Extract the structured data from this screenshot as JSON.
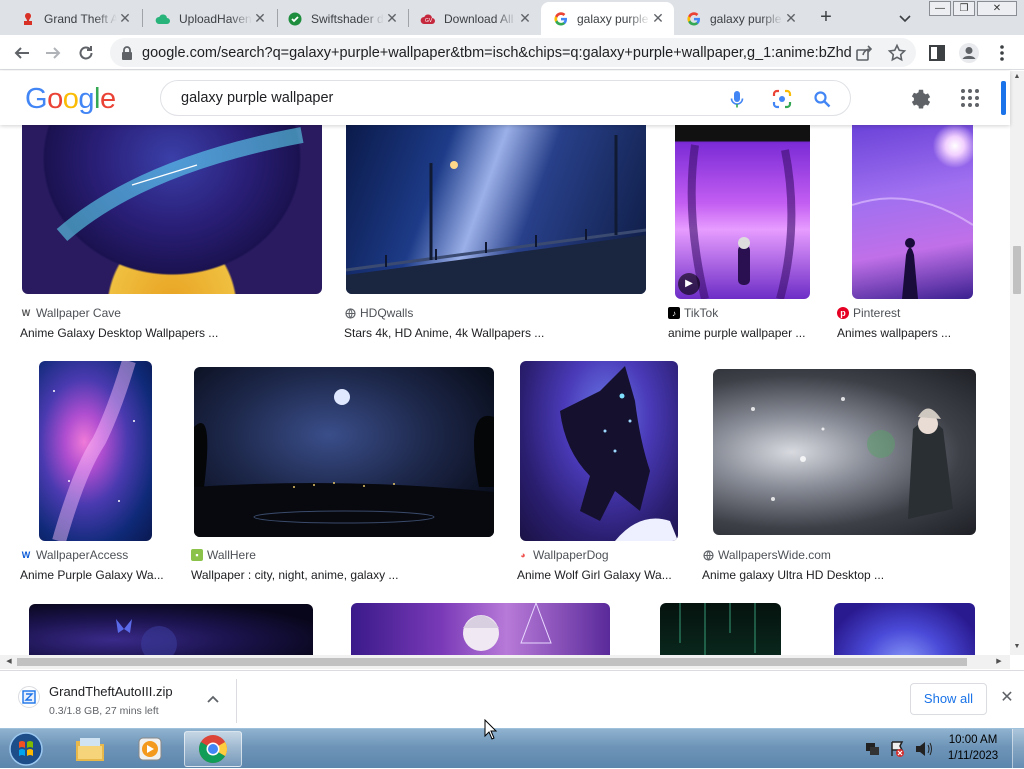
{
  "browser": {
    "tabs": [
      {
        "title": "Grand Theft Auto III",
        "icon": "pdf-red-icon",
        "active": false
      },
      {
        "title": "UploadHaven",
        "icon": "cloud-green-icon",
        "active": false
      },
      {
        "title": "Swiftshader dll",
        "icon": "check-shield-icon",
        "active": false
      },
      {
        "title": "Download All",
        "icon": "cloud-red-icon",
        "active": false
      },
      {
        "title": "galaxy purple wallpaper",
        "icon": "google-icon",
        "active": true
      },
      {
        "title": "galaxy purple wallpaper",
        "icon": "google-icon",
        "active": false
      }
    ],
    "new_tab": "+",
    "tab_search": "⌄",
    "window_controls": [
      "—",
      "❐",
      "✕"
    ],
    "url": "google.com/search?q=galaxy+purple+wallpaper&tbm=isch&chips=q:galaxy+purple+wallpaper,g_1:anime:bZhd..."
  },
  "google": {
    "logo": [
      "G",
      "o",
      "o",
      "g",
      "l",
      "e"
    ],
    "logo_colors": [
      "#4285f4",
      "#ea4335",
      "#fbbc05",
      "#4285f4",
      "#34a853",
      "#ea4335"
    ],
    "query": "galaxy purple wallpaper"
  },
  "results": [
    {
      "source": "Wallpaper Cave",
      "caption": "Anime Galaxy Desktop Wallpapers ...",
      "src_icon": "wallpapercave-icon"
    },
    {
      "source": "HDQwalls",
      "caption": "Stars 4k, HD Anime, 4k Wallpapers ...",
      "src_icon": "globe-icon"
    },
    {
      "source": "TikTok",
      "caption": "anime purple wallpaper ...",
      "src_icon": "tiktok-icon"
    },
    {
      "source": "Pinterest",
      "caption": "Animes wallpapers ...",
      "src_icon": "pinterest-icon"
    },
    {
      "source": "WallpaperAccess",
      "caption": "Anime Purple Galaxy Wa...",
      "src_icon": "wallpaperaccess-icon"
    },
    {
      "source": "WallHere",
      "caption": "Wallpaper : city, night, anime, galaxy ...",
      "src_icon": "wallhere-icon"
    },
    {
      "source": "WallpaperDog",
      "caption": "Anime Wolf Girl Galaxy Wa...",
      "src_icon": "wallpaperdog-icon"
    },
    {
      "source": "WallpapersWide.com",
      "caption": "Anime galaxy Ultra HD Desktop ...",
      "src_icon": "globe-icon"
    }
  ],
  "download": {
    "filename": "GrandTheftAutoIII.zip",
    "status": "0.3/1.8 GB, 27 mins left",
    "show_all": "Show all",
    "close": "✕"
  },
  "taskbar": {
    "time": "10:00 AM",
    "date": "1/11/2023"
  }
}
